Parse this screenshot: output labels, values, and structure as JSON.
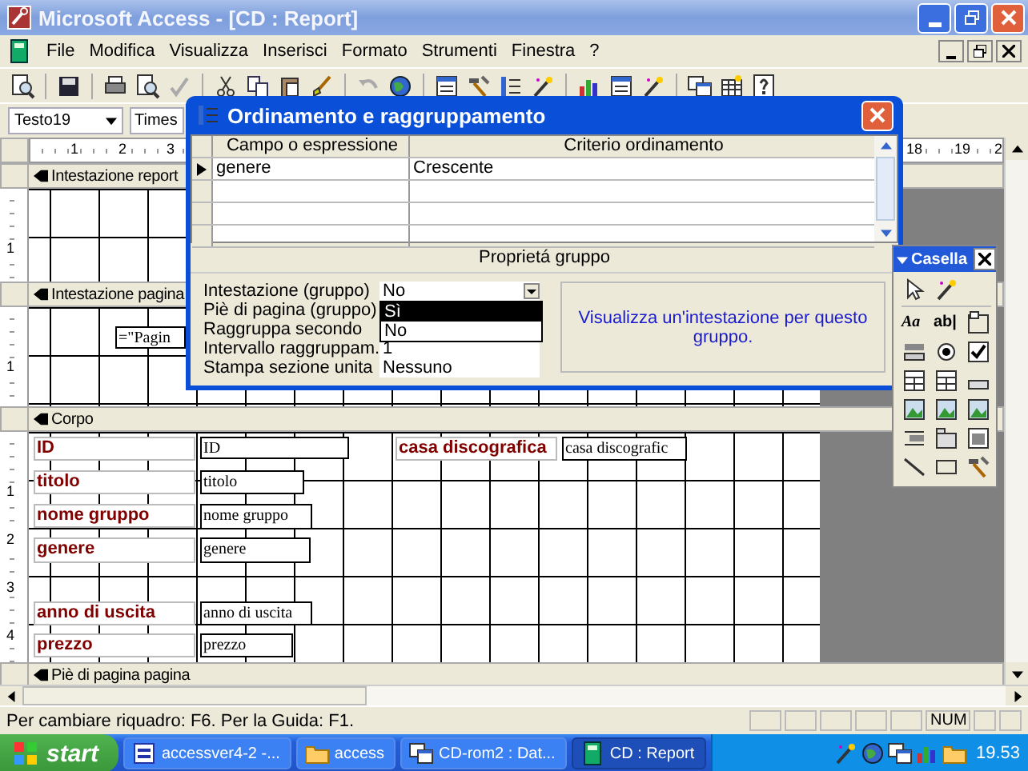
{
  "window": {
    "title": "Microsoft Access - [CD : Report]"
  },
  "menu": [
    "File",
    "Modifica",
    "Visualizza",
    "Inserisci",
    "Formato",
    "Strumenti",
    "Finestra",
    "?"
  ],
  "format_bar": {
    "object": "Testo19",
    "font": "Times"
  },
  "ruler": {
    "left_marks": [
      "1",
      "2",
      "3"
    ],
    "right_marks": [
      "18",
      "19",
      "2"
    ]
  },
  "sections": [
    {
      "title": "Intestazione report",
      "ruler_marks": [
        "1"
      ]
    },
    {
      "title": "Intestazione pagina",
      "ruler_marks": [
        "1"
      ],
      "controls": [
        {
          "kind": "textbox",
          "text": "=\"Pagin"
        }
      ]
    },
    {
      "title": "Corpo",
      "ruler_marks": [
        "1",
        "2",
        "3",
        "4"
      ],
      "controls": [
        {
          "kind": "label",
          "text": "ID"
        },
        {
          "kind": "textbox",
          "text": "ID"
        },
        {
          "kind": "label",
          "text": "casa discografica"
        },
        {
          "kind": "textbox",
          "text": "casa discografic"
        },
        {
          "kind": "label",
          "text": "titolo"
        },
        {
          "kind": "textbox",
          "text": "titolo"
        },
        {
          "kind": "label",
          "text": "nome gruppo"
        },
        {
          "kind": "textbox",
          "text": "nome gruppo"
        },
        {
          "kind": "label",
          "text": "genere"
        },
        {
          "kind": "textbox",
          "text": "genere"
        },
        {
          "kind": "label",
          "text": "anno di uscita"
        },
        {
          "kind": "textbox",
          "text": "anno di uscita"
        },
        {
          "kind": "label",
          "text": "prezzo"
        },
        {
          "kind": "textbox",
          "text": "prezzo"
        }
      ]
    },
    {
      "title": "Piè di pagina pagina"
    }
  ],
  "dialog": {
    "title": "Ordinamento e raggruppamento",
    "columns": [
      "Campo o espressione",
      "Criterio ordinamento"
    ],
    "rows": [
      {
        "field": "genere",
        "order": "Crescente",
        "selected": true
      }
    ],
    "properties_title": "Proprietá gruppo",
    "properties": [
      {
        "label": "Intestazione (gruppo)",
        "value": "No",
        "dropdown": true
      },
      {
        "label": "Piè di pagina (gruppo)"
      },
      {
        "label": "Raggruppa secondo"
      },
      {
        "label": "Intervallo raggruppam.",
        "value": "1"
      },
      {
        "label": "Stampa sezione unita",
        "value": "Nessuno"
      }
    ],
    "dropdown_options": [
      {
        "label": "Sì",
        "selected": true
      },
      {
        "label": "No",
        "selected": false
      }
    ],
    "hint": "Visualizza un'intestazione per questo gruppo."
  },
  "toolbox": {
    "title": "Casella",
    "label_tool": "Aa",
    "textbox_tool": "ab|"
  },
  "status_bar": {
    "text": "Per cambiare riquadro: F6. Per la Guida: F1.",
    "indicator": "NUM"
  },
  "taskbar": {
    "start": "start",
    "tasks": [
      {
        "label": "accessver4-2 -...",
        "selected": false
      },
      {
        "label": "access",
        "selected": false
      },
      {
        "label": "CD-rom2 : Dat...",
        "selected": false
      },
      {
        "label": "CD : Report",
        "selected": true
      }
    ],
    "clock": "19.53"
  }
}
